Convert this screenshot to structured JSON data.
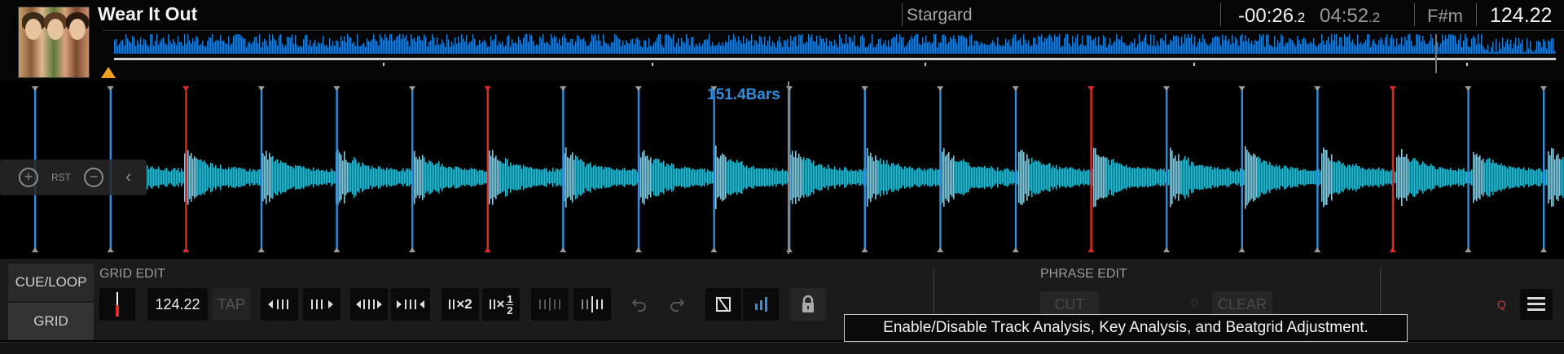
{
  "track": {
    "title": "Wear It Out",
    "artist": "Stargard",
    "remaining_main": "-00:26",
    "remaining_frac": ".2",
    "total_main": "04:52",
    "total_frac": ".2",
    "key": "F#m",
    "bpm": "124.22"
  },
  "waveform": {
    "bars_label": "151.4Bars",
    "zoom": {
      "reset_label": "RST"
    },
    "beat_color": "#2f8ee0",
    "downbeat_color": "#e02a2a",
    "wave_color": "#37d6f0"
  },
  "tabs": {
    "cue_loop": "CUE/LOOP",
    "grid": "GRID"
  },
  "grid_edit": {
    "label": "GRID EDIT",
    "bpm_value": "124.22",
    "tap_label": "TAP",
    "double_label": "×2",
    "half_num": "1",
    "half_den": "2"
  },
  "phrase_edit": {
    "label": "PHRASE EDIT",
    "cut_label": "CUT",
    "clear_label": "CLEAR"
  },
  "quantize_label": "Q",
  "tooltip": "Enable/Disable Track Analysis, Key Analysis, and Beatgrid Adjustment.",
  "icons": [
    "zoom-in-icon",
    "zoom-out-icon",
    "chevron-left-icon",
    "undo-icon",
    "redo-icon",
    "lock-icon",
    "menu-icon"
  ]
}
